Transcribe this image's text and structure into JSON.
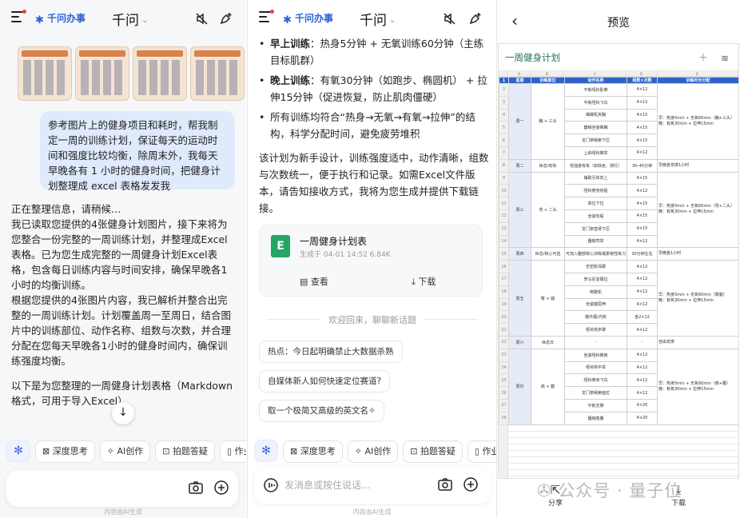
{
  "left": {
    "logo": "千问办事",
    "title": "千问",
    "user_message": "参考图片上的健身项目和耗时，帮我制定一周的训练计划，保证每天的运动时间和强度比较均衡，除周末外，我每天早晚各有 1 小时的健身时间，把健身计划整理成 excel 表格发发我",
    "reply": [
      "正在整理信息，请稍候…",
      "我已读取您提供的4张健身计划图片，接下来将为您整合一份完整的一周训练计划，并整理成Excel表格。已为您生成完整的一周健身计划Excel表格，包含每日训练内容与时间安排，确保早晚各1小时的均衡训练。",
      "根据您提供的4张图片内容，我已解析并整合出完整的一周训练计划。计划覆盖周一至周日，结合图片中的训练部位、动作名称、组数与次数，并合理分配在您每天早晚各1小时的健身时间内，确保训练强度均衡。",
      "以下是为您整理的一周健身计划表格（Markdown格式，可用于导入Excel）"
    ],
    "chips": [
      "深度思考",
      "AI创作",
      "拍题答疑",
      "作业"
    ],
    "footnote": "内容由AI生成"
  },
  "middle": {
    "logo": "千问办事",
    "title": "千问",
    "bullets": [
      {
        "label": "早上训练",
        "text": "：热身5分钟 + 无氧训练60分钟（主练目标肌群）"
      },
      {
        "label": "晚上训练",
        "text": "：有氧30分钟（如跑步、椭圆机） + 拉伸15分钟（促进恢复，防止肌肉僵硬）"
      },
      {
        "label": "",
        "text": "所有训练均符合“热身→无氧→有氧→拉伸”的结构，科学分配时间，避免疲劳堆积"
      }
    ],
    "para": "该计划为新手设计，训练强度适中，动作清晰，组数与次数统一，便于执行和记录。如需Excel文件版本，请告知接收方式，我将为您生成并提供下载链接。",
    "file": {
      "name": "一周健身计划表",
      "meta": "生成于 04-01 14:52 6.84K",
      "view": "查看",
      "download": "下载"
    },
    "divider": "欢迎回来，聊聊新话题",
    "suggestions": [
      "热点：今日起明确禁止大数据杀熟",
      "自媒体新人如何快速定位赛道?",
      "取一个极简又高级的英文名✧"
    ],
    "chips": [
      "深度思考",
      "AI创作",
      "拍题答疑",
      "作业"
    ],
    "placeholder": "发消息或按住说话...",
    "footnote": "内容由AI生成"
  },
  "right": {
    "title": "预览",
    "sheet_name": "一周健身计划",
    "col_letters": [
      "A",
      "B",
      "C",
      "D",
      "E"
    ],
    "headers": [
      "星期",
      "训练部位",
      "动作名称",
      "组数×次数",
      "训练时长分配"
    ],
    "rows": [
      [
        "周一",
        "胸 + 三头",
        "平板哑铃卧推",
        "4×12",
        "早：热身5min + 无氧60min（胸+三头）\n晚：有氧30min + 拉伸15min"
      ],
      [
        "",
        "",
        "平板哑铃飞鸟",
        "4×12",
        ""
      ],
      [
        "",
        "",
        "蝴蝶机夹胸",
        "4×15",
        ""
      ],
      [
        "",
        "",
        "器械坐姿推胸",
        "4×15",
        ""
      ],
      [
        "",
        "",
        "龙门架绳索下压",
        "4×15",
        ""
      ],
      [
        "",
        "",
        "上斜哑铃推举",
        "4×12",
        ""
      ],
      [
        "周二",
        "休息/有氧",
        "低强度有氧（如快走、骑行）",
        "30–45分钟",
        "早晚各安排1小时"
      ],
      [
        "周三",
        "背 + 二头",
        "辅助引体向上",
        "4×15",
        "早：热身5min + 无氧60min（背+二头）\n晚：有氧30min + 拉伸15min"
      ],
      [
        "",
        "",
        "哑铃俯身划船",
        "4×12",
        ""
      ],
      [
        "",
        "",
        "高位下拉",
        "4×15",
        ""
      ],
      [
        "",
        "",
        "坐姿划船",
        "4×15",
        ""
      ],
      [
        "",
        "",
        "龙门架直臂下压",
        "4×15",
        ""
      ],
      [
        "",
        "",
        "器械弯举",
        "4×12",
        ""
      ],
      [
        "周四",
        "休息/核心可选",
        "可加入腹部核心训练或柔韧性练习",
        "30分钟左右",
        "早晚各1小时"
      ],
      [
        "周五",
        "臀 + 腿",
        "史密斯深蹲",
        "4×12",
        "早：热身5min + 无氧60min（臀腿）\n晚：有氧30min + 拉伸15min"
      ],
      [
        "",
        "",
        "罗马尼亚硬拉",
        "4×12",
        ""
      ],
      [
        "",
        "",
        "倒蹬机",
        "4×12",
        ""
      ],
      [
        "",
        "",
        "坐姿腿屈伸",
        "4×12",
        ""
      ],
      [
        "",
        "",
        "髋外展/内收",
        "各2×12",
        ""
      ],
      [
        "",
        "",
        "哑铃箭步蹲",
        "4×12",
        ""
      ],
      [
        "周六",
        "休息日",
        "-",
        "-",
        "自由安排"
      ],
      [
        "周日",
        "肩 + 腹",
        "坐姿哑铃推肩",
        "4×12",
        "早：热身5min + 无氧60min（肩+腹）\n晚：有氧30min + 拉伸15min"
      ],
      [
        "",
        "",
        "哑铃侧平举",
        "4×12",
        ""
      ],
      [
        "",
        "",
        "哑铃俯身飞鸟",
        "4×12",
        ""
      ],
      [
        "",
        "",
        "龙门架绳索面拉",
        "4×12",
        ""
      ],
      [
        "",
        "",
        "平板支撑",
        "4×20",
        ""
      ],
      [
        "",
        "",
        "器械卷腹",
        "4×20",
        ""
      ]
    ],
    "share": "分享",
    "download": "下载",
    "watermark": "公众号 · 量子位"
  }
}
